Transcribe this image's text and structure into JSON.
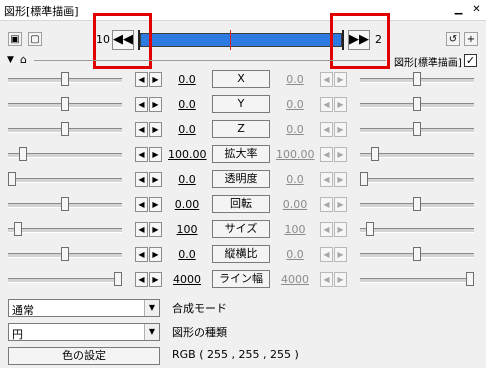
{
  "window": {
    "title": "図形[標準描画]",
    "close_glyph": "✕"
  },
  "toolbar": {
    "prev_label": "◀◀",
    "next_label": "▶▶",
    "frame_start": "10",
    "frame_end": "2",
    "refresh_glyph": "↺",
    "add_glyph": "+",
    "object_label": "図形[標準描画]"
  },
  "params": [
    {
      "name": "X",
      "left": "0.0",
      "right": "0.0",
      "lpos": 0.5,
      "rpos": 0.5
    },
    {
      "name": "Y",
      "left": "0.0",
      "right": "0.0",
      "lpos": 0.5,
      "rpos": 0.5
    },
    {
      "name": "Z",
      "left": "0.0",
      "right": "0.0",
      "lpos": 0.5,
      "rpos": 0.5
    },
    {
      "name": "拡大率",
      "left": "100.00",
      "right": "100.00",
      "lpos": 0.1,
      "rpos": 0.1
    },
    {
      "name": "透明度",
      "left": "0.0",
      "right": "0.0",
      "lpos": 0.0,
      "rpos": 0.0
    },
    {
      "name": "回転",
      "left": "0.00",
      "right": "0.00",
      "lpos": 0.5,
      "rpos": 0.5
    },
    {
      "name": "サイズ",
      "left": "100",
      "right": "100",
      "lpos": 0.06,
      "rpos": 0.06
    },
    {
      "name": "縦横比",
      "left": "0.0",
      "right": "0.0",
      "lpos": 0.5,
      "rpos": 0.5
    },
    {
      "name": "ライン幅",
      "left": "4000",
      "right": "4000",
      "lpos": 1.0,
      "rpos": 1.0
    }
  ],
  "blend": {
    "value": "通常",
    "caption": "合成モード"
  },
  "shape": {
    "value": "円",
    "caption": "図形の種類"
  },
  "color": {
    "button": "色の設定",
    "rgb": "RGB ( 255 , 255 , 255 )"
  }
}
